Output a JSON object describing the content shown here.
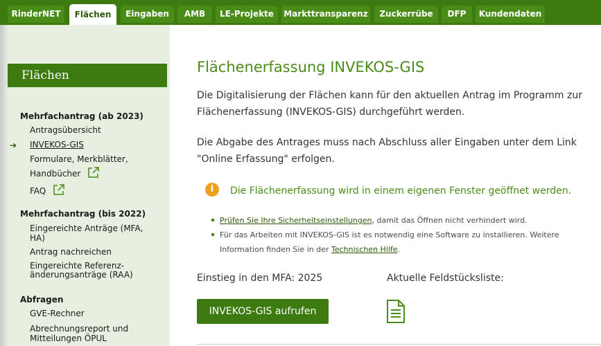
{
  "nav": {
    "tabs": [
      {
        "label": "RinderNET"
      },
      {
        "label": "Flächen",
        "active": true
      },
      {
        "label": "Eingaben"
      },
      {
        "label": "AMB"
      },
      {
        "label": "LE-Projekte"
      },
      {
        "label": "Markttransparenz"
      },
      {
        "label": "Zuckerrübe"
      },
      {
        "label": "DFP"
      },
      {
        "label": "Kundendaten"
      }
    ]
  },
  "sidebar": {
    "header": "Flächen",
    "sections": [
      {
        "title": "Mehrfachantrag (ab 2023)",
        "items": [
          "Antragsübersicht",
          "INVEKOS-GIS",
          "Formulare, Merkblätter,",
          "Handbücher",
          "FAQ"
        ]
      },
      {
        "title": "Mehrfachantrag (bis 2022)",
        "items": [
          "Eingereichte Anträge (MFA,",
          "HA)",
          "Antrag nachreichen",
          "Eingereichte Referenz-",
          "änderungsanträge (RAA)"
        ]
      },
      {
        "title": "Abfragen",
        "items": [
          "GVE-Rechner",
          "Abrechnungsreport und",
          "Mitteilungen ÖPUL"
        ]
      }
    ]
  },
  "main": {
    "title": "Flächenerfassung INVEKOS-GIS",
    "para1_line1": "Die Digitalisierung der Flächen kann für den aktuellen Antrag im Programm zur",
    "para1_line2": "Flächenerfassung (INVEKOS-GIS) durchgeführt werden.",
    "para2_line1": "Die Abgabe des Antrages muss nach Abschluss aller Eingaben unter dem Link",
    "para2_line2": "\"Online Erfassung\" erfolgen.",
    "info_icon": "i",
    "info_text": "Die Flächenerfassung wird in einem eigenen Fenster geöffnet werden.",
    "bullet1_link": "Prüfen Sie Ihre Sicherheitseinstellungen",
    "bullet1_rest": ", damit das Öffnen nicht verhindert wird.",
    "bullet2_line1": "Für das Arbeiten mit INVEKOS-GIS ist es notwendig eine Software zu installieren. Weitere",
    "bullet2_pre": "Information finden Sie in der ",
    "bullet2_link": "Technischen Hilfe",
    "bullet2_post": ".",
    "einstieg_label": "Einstieg in den MFA: 2025",
    "feldstueck_label": "Aktuelle Feldstücksliste:",
    "button_label": "INVEKOS-GIS aufrufen",
    "doc_icon": "document-icon"
  },
  "colors": {
    "brand": "#3d7a10",
    "accent_text": "#4a8c18",
    "info": "#f0a020"
  }
}
